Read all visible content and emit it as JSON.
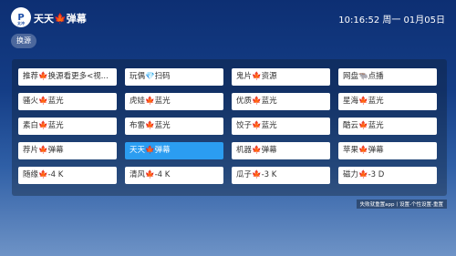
{
  "header": {
    "logo_text": "P",
    "logo_sub": "太冲",
    "title": "天天🍁弹幕",
    "clock": "10:16:52 周一 01月05日"
  },
  "switch_label": "换源",
  "sources": [
    "推荐🍁换源看更多<视...",
    "玩偶💎扫码",
    "鬼片🍁资源",
    "网盘🐃点播",
    "骚火🍁蓝光",
    "虎娃🍁蓝光",
    "优质🍁蓝光",
    "星海🍁蓝光",
    "素白🍁蓝光",
    "布雷🍁蓝光",
    "饺子🍁蓝光",
    "酷云🍁蓝光",
    "荐片🍁弹幕",
    "天天🍁弹幕",
    "机器🍁弹幕",
    "苹果🍁弹幕",
    "随缘🍁-4 K",
    "清风🍁-4 K",
    "瓜子🍁-3 K",
    "磁力🍁-3 D"
  ],
  "active_index": 13,
  "footer": "失败就重置app丨设置-个性设置-重置"
}
